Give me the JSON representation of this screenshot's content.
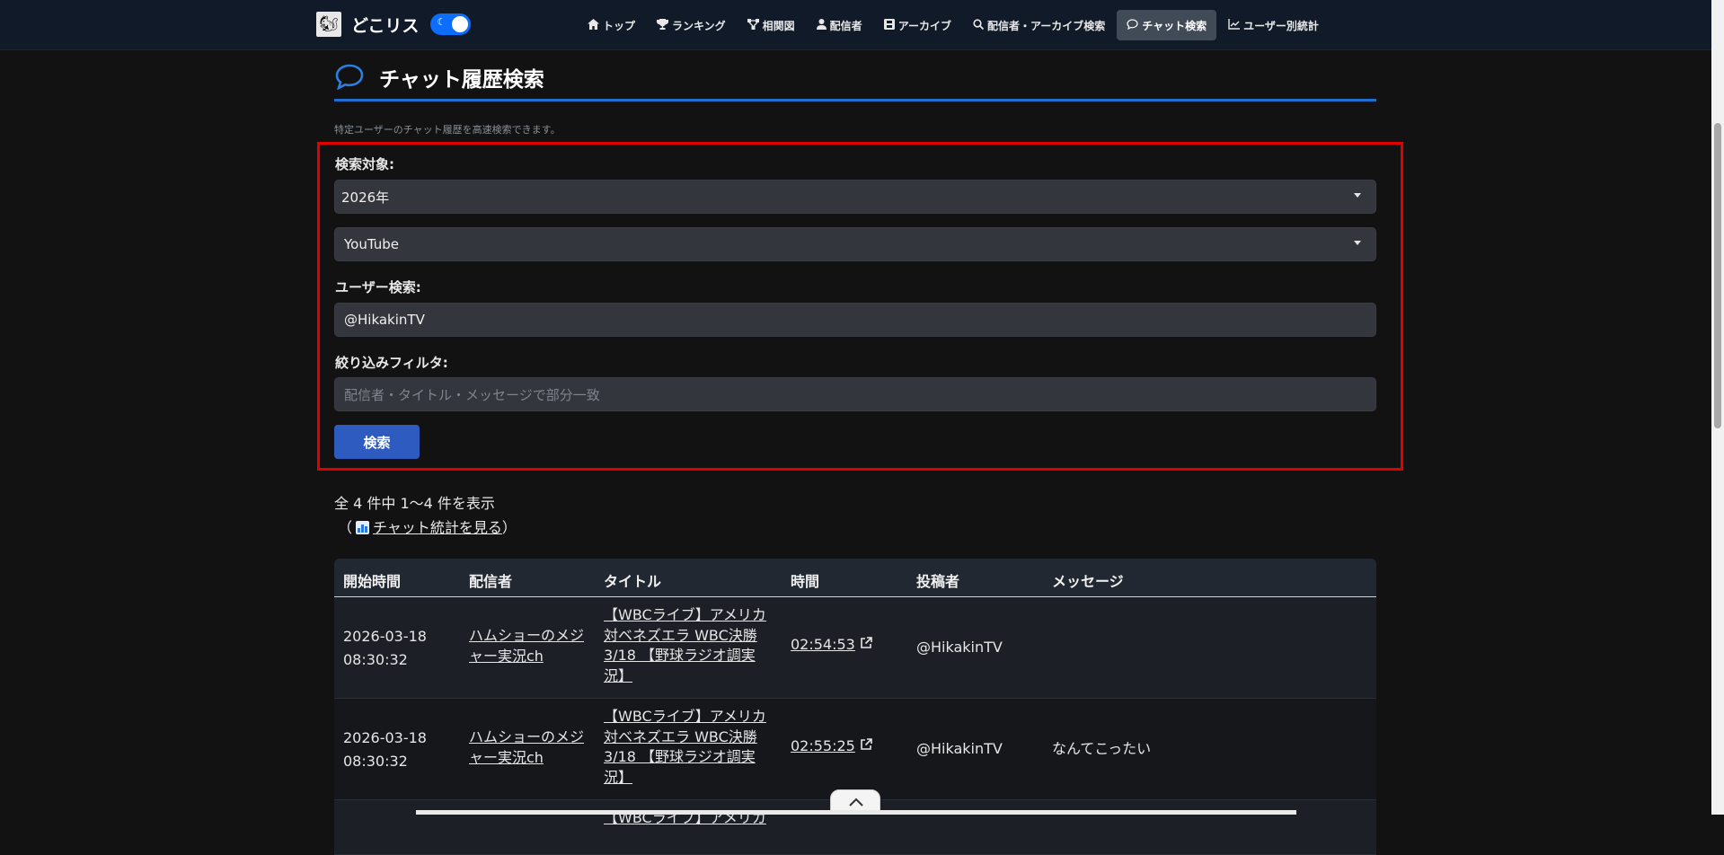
{
  "navbar": {
    "brand_name": "どこリス",
    "items": [
      {
        "label": "トップ",
        "icon": "home-icon"
      },
      {
        "label": "ランキング",
        "icon": "trophy-icon"
      },
      {
        "label": "相関図",
        "icon": "diagram-icon"
      },
      {
        "label": "配信者",
        "icon": "person-icon"
      },
      {
        "label": "アーカイブ",
        "icon": "film-icon"
      },
      {
        "label": "配信者・アーカイブ検索",
        "icon": "search-icon"
      },
      {
        "label": "チャット検索",
        "icon": "chat-icon",
        "active": true
      },
      {
        "label": "ユーザー別統計",
        "icon": "line-chart-icon"
      }
    ]
  },
  "page": {
    "title": "チャット履歴検索",
    "description": "特定ユーザーのチャット履歴を高速検索できます。"
  },
  "form": {
    "target_label": "検索対象:",
    "year_value": "2026年",
    "platform_value": "YouTube",
    "user_label": "ユーザー検索:",
    "user_value": "@HikakinTV",
    "filter_label": "絞り込みフィルタ:",
    "filter_placeholder": "配信者・タイトル・メッセージで部分一致",
    "search_button": "検索"
  },
  "results": {
    "count_text": "全 4 件中 1〜4 件を表示",
    "stats_open": "（",
    "stats_link": "チャット統計を見る",
    "stats_close": "）"
  },
  "table": {
    "headers": [
      "開始時間",
      "配信者",
      "タイトル",
      "時間",
      "投稿者",
      "メッセージ"
    ],
    "rows": [
      {
        "start_date": "2026-03-18",
        "start_time": "08:30:32",
        "streamer_1": "ハムショーのメジ",
        "streamer_2": "ャー実況ch",
        "title_1": "【WBCライブ】アメリカ",
        "title_2": "対ベネズエラ WBC決勝",
        "title_3": "3/18 【野球ラジオ調実",
        "title_4": "況】",
        "time": "02:54:53",
        "poster": "@HikakinTV",
        "message": ""
      },
      {
        "start_date": "2026-03-18",
        "start_time": "08:30:32",
        "streamer_1": "ハムショーのメジ",
        "streamer_2": "ャー実況ch",
        "title_1": "【WBCライブ】アメリカ",
        "title_2": "対ベネズエラ WBC決勝",
        "title_3": "3/18 【野球ラジオ調実",
        "title_4": "況】",
        "time": "02:55:25",
        "poster": "@HikakinTV",
        "message": "なんてこったい"
      },
      {
        "title_1": "【WBCライブ】アメリカ"
      }
    ]
  }
}
